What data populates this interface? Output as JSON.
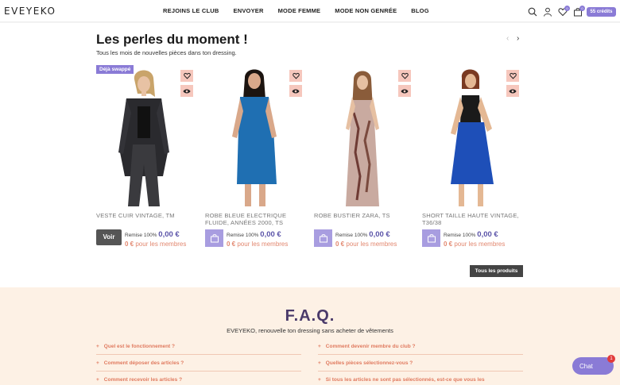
{
  "header": {
    "logo": "EVEYEKO",
    "nav": [
      "REJOINS LE CLUB",
      "ENVOYER",
      "MODE FEMME",
      "MODE NON GENRÉE",
      "BLOG"
    ],
    "wishlist_count": "0",
    "cart_count": "0",
    "credits": "55 crédits"
  },
  "section": {
    "title": "Les perles du moment !",
    "subtitle": "Tous les mois de nouvelles pièces dans ton dressing.",
    "prev_arrow": "‹",
    "next_arrow": "›"
  },
  "products": [
    {
      "badge": "Déjà swappé",
      "name": "VESTE CUIR VINTAGE, TM",
      "action_label": "Voir",
      "discount_text": "Remise 100%",
      "price": "0,00 €",
      "member_price": "0 €",
      "member_text": "pour les membres"
    },
    {
      "name": "ROBE BLEUE ELECTRIQUE FLUIDE, ANNÉES 2000, TS",
      "discount_text": "Remise 100%",
      "price": "0,00 €",
      "member_price": "0 €",
      "member_text": "pour les membres"
    },
    {
      "name": "ROBE BUSTIER ZARA, TS",
      "discount_text": "Remise 100%",
      "price": "0,00 €",
      "member_price": "0 €",
      "member_text": "pour les membres"
    },
    {
      "name": "SHORT TAILLE HAUTE VINTAGE, T36/38",
      "discount_text": "Remise 100%",
      "price": "0,00 €",
      "member_price": "0 €",
      "member_text": "pour les membres"
    }
  ],
  "all_products_label": "Tous les produits",
  "faq": {
    "title": "F.A.Q.",
    "subtitle": "EVEYEKO, renouvelle ton dressing sans acheter de vêtements",
    "left": [
      "Quel est le fonctionnement ?",
      "Comment déposer des articles ?",
      "Comment recevoir les articles ?"
    ],
    "right": [
      "Comment devenir membre du club ?",
      "Quelles pièces sélectionnez-vous ?",
      "Si tous les articles ne sont pas sélectionnés, est-ce que vous les"
    ]
  },
  "chat": {
    "label": "Chat",
    "badge": "1"
  },
  "colors": {
    "accent": "#8a7bd6",
    "price": "#5a53a8",
    "member": "#e2876f",
    "faq_bg": "#fdf1e5",
    "icon_btn_bg": "#f6c7bd"
  }
}
